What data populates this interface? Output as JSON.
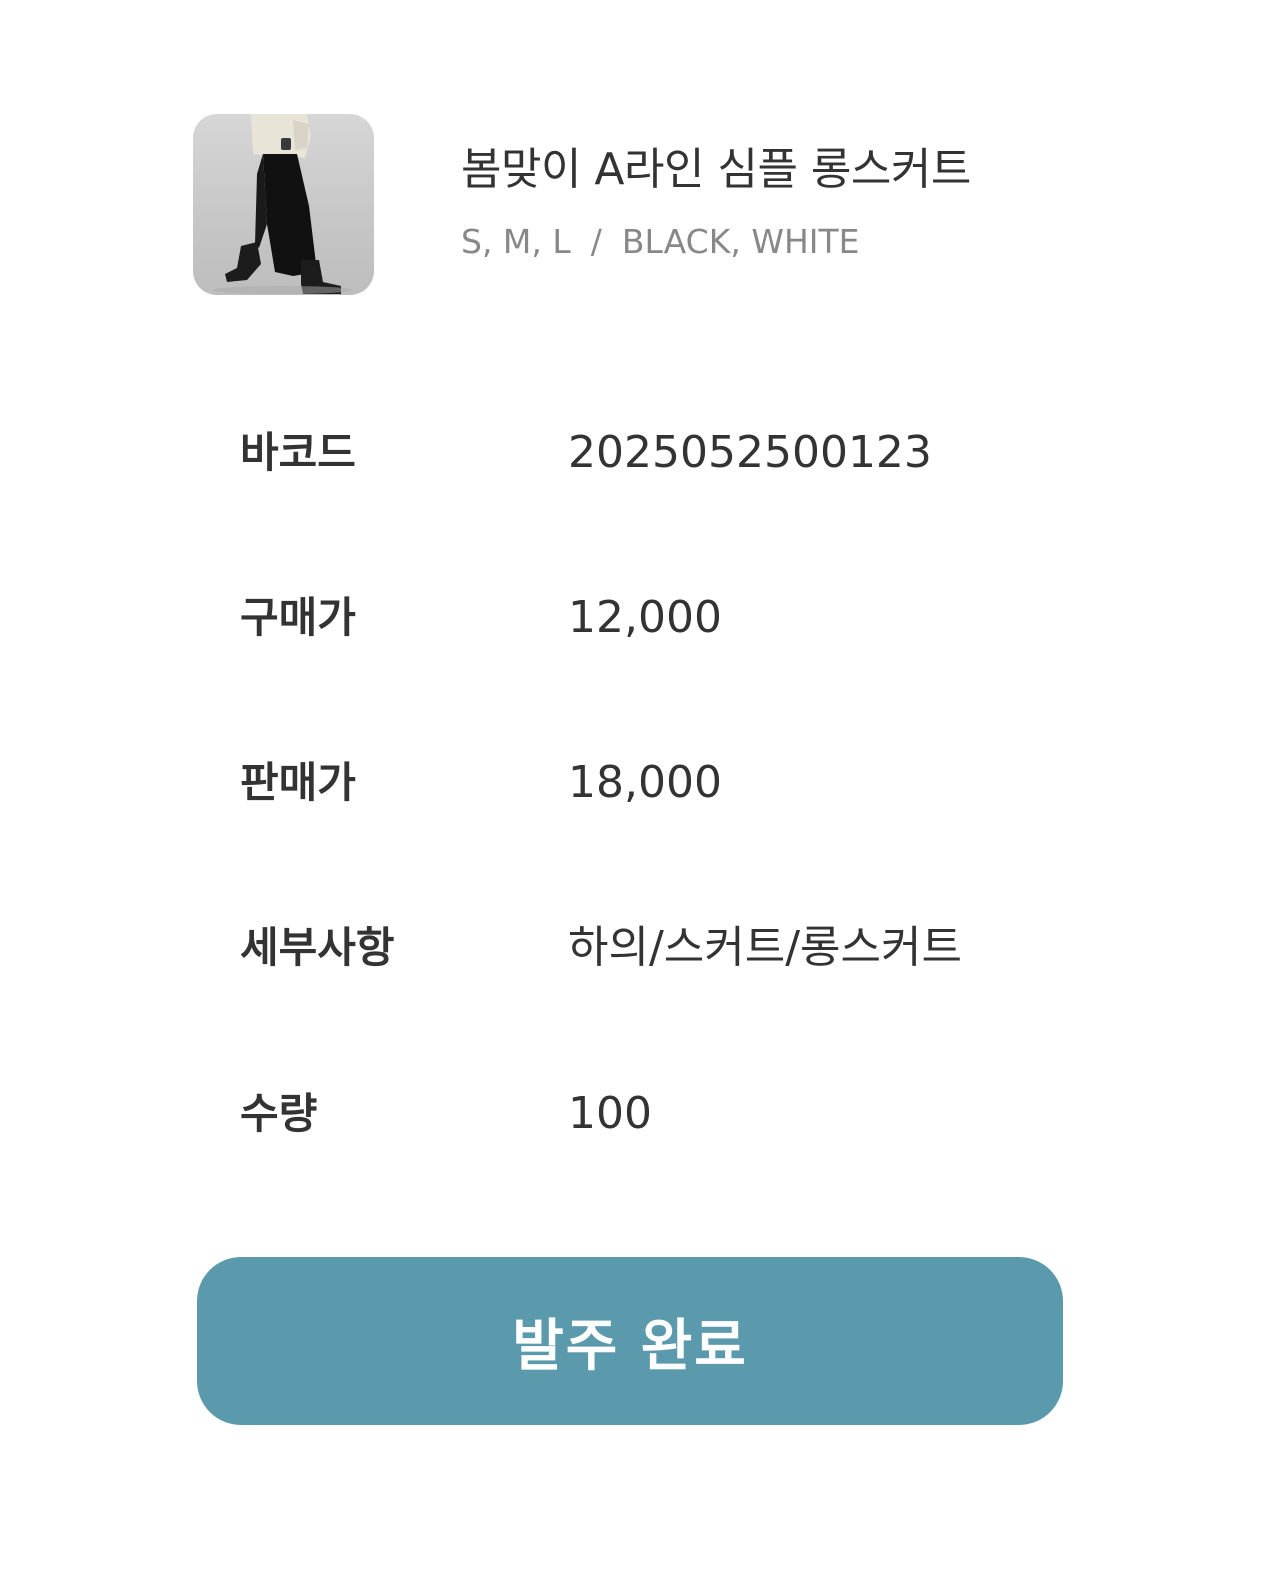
{
  "product": {
    "image_alt": "long skirt product photo",
    "title": "봄맞이 A라인 심플 롱스커트",
    "sizes": "S, M, L",
    "separator": "/",
    "colors": "BLACK, WHITE"
  },
  "details": [
    {
      "label": "바코드",
      "value": "2025052500123"
    },
    {
      "label": "구매가",
      "value": "12,000"
    },
    {
      "label": "판매가",
      "value": "18,000"
    },
    {
      "label": "세부사항",
      "value": "하의/스커트/롱스커트"
    },
    {
      "label": "수량",
      "value": "100"
    }
  ],
  "actions": {
    "complete_label": "발주 완료"
  },
  "colors": {
    "button_bg": "#5b9aad",
    "text_primary": "#333333",
    "text_secondary": "#888888"
  }
}
